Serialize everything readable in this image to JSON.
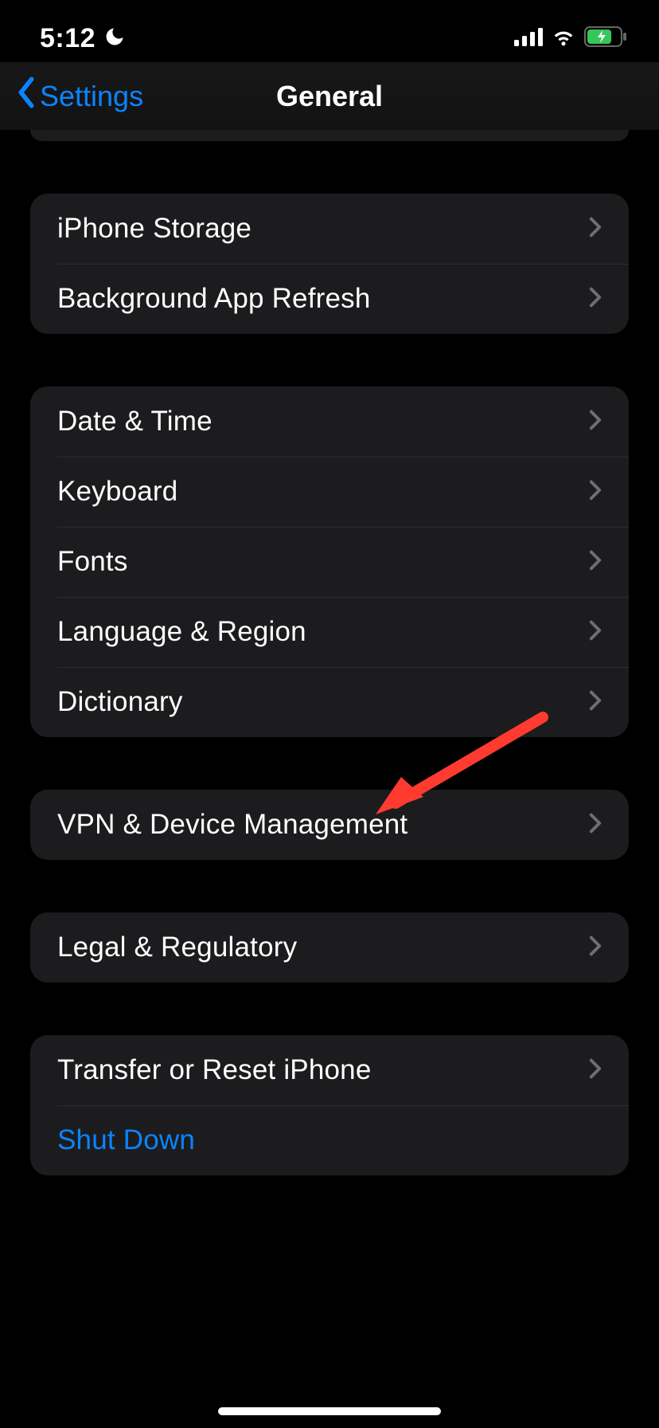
{
  "status": {
    "time": "5:12"
  },
  "nav": {
    "back_label": "Settings",
    "title": "General"
  },
  "groups": {
    "g1": {
      "storage": "iPhone Storage",
      "bg_refresh": "Background App Refresh"
    },
    "g2": {
      "date_time": "Date & Time",
      "keyboard": "Keyboard",
      "fonts": "Fonts",
      "lang_region": "Language & Region",
      "dictionary": "Dictionary"
    },
    "g3": {
      "vpn": "VPN & Device Management"
    },
    "g4": {
      "legal": "Legal & Regulatory"
    },
    "g5": {
      "transfer": "Transfer or Reset iPhone",
      "shutdown": "Shut Down"
    }
  }
}
